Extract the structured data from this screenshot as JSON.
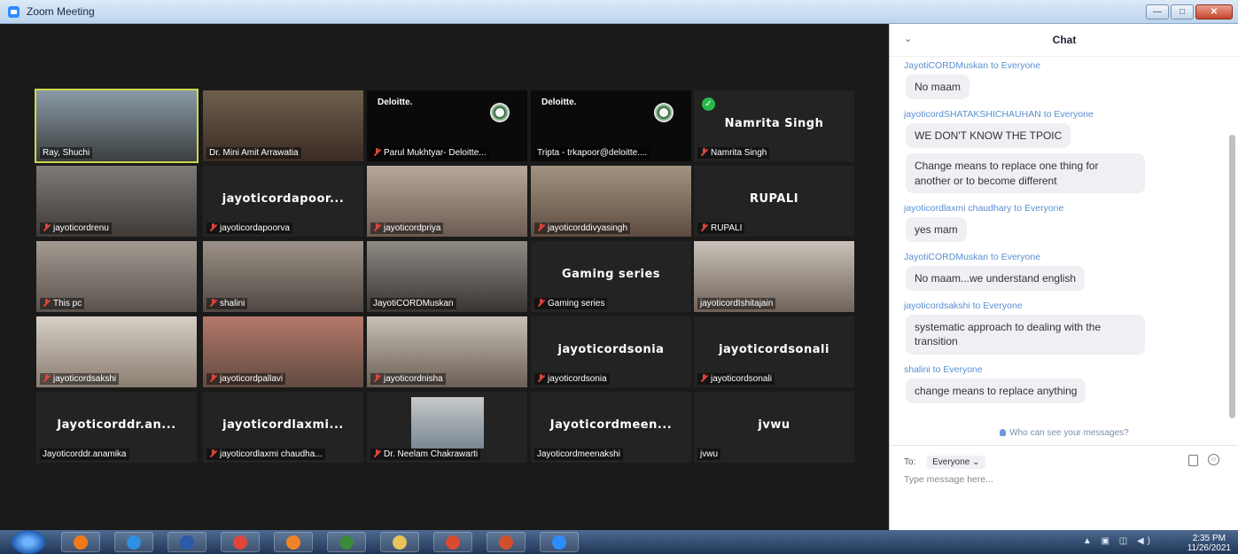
{
  "window": {
    "title": "Zoom Meeting",
    "buttons": [
      "—",
      "□",
      "✕"
    ]
  },
  "gallery": [
    {
      "name": "Ray, Shuchi",
      "big": "",
      "muted": false,
      "kind": "video",
      "bg": "linear-gradient(#8a9aa6,#3b3f3f)",
      "active": true
    },
    {
      "name": "Dr. Mini Amit Arrawatia",
      "big": "",
      "muted": false,
      "kind": "video",
      "bg": "linear-gradient(#6f5f4d,#3a2c24)"
    },
    {
      "name": "Parul Mukhtyar- Deloitte...",
      "big": "",
      "muted": true,
      "kind": "deloitte",
      "bg": "#0a0a0a"
    },
    {
      "name": "Tripta - trkapoor@deloitte....",
      "big": "",
      "muted": false,
      "kind": "deloitte",
      "bg": "#0a0a0a"
    },
    {
      "name": "Namrita Singh",
      "big": "Namrita Singh",
      "muted": true,
      "kind": "name",
      "check": true
    },
    {
      "name": "jayoticordrenu",
      "big": "",
      "muted": true,
      "kind": "video",
      "bg": "linear-gradient(#7e7a78,#3f3a36)"
    },
    {
      "name": "jayoticordapoorva",
      "big": "jayoticordapoor...",
      "muted": true,
      "kind": "name"
    },
    {
      "name": "jayoticordpriya",
      "big": "",
      "muted": true,
      "kind": "video",
      "bg": "linear-gradient(#b8a89a,#6c5b52)"
    },
    {
      "name": "jayoticorddivyasingh",
      "big": "",
      "muted": true,
      "kind": "video",
      "bg": "linear-gradient(#a49381,#5e4c40)"
    },
    {
      "name": "RUPALI",
      "big": "RUPALI",
      "muted": true,
      "kind": "name"
    },
    {
      "name": "This pc",
      "big": "",
      "muted": true,
      "kind": "video",
      "bg": "linear-gradient(#a39b92,#5b524c)"
    },
    {
      "name": "shalini",
      "big": "",
      "muted": true,
      "kind": "video",
      "bg": "linear-gradient(#9c9289,#4f4741)"
    },
    {
      "name": "JayotiCORDMuskan",
      "big": "",
      "muted": false,
      "kind": "video",
      "bg": "linear-gradient(#8e8a84,#3a3532)"
    },
    {
      "name": "Gaming series",
      "big": "Gaming series",
      "muted": true,
      "kind": "name"
    },
    {
      "name": "jayoticordIshitajain",
      "big": "",
      "muted": false,
      "kind": "video",
      "bg": "linear-gradient(#c9c2b9,#6f6259)"
    },
    {
      "name": "jayoticordsakshi",
      "big": "",
      "muted": true,
      "kind": "video",
      "bg": "linear-gradient(#d6d0c6,#8a7c70)"
    },
    {
      "name": "jayoticordpallavi",
      "big": "",
      "muted": true,
      "kind": "video",
      "bg": "linear-gradient(#b6786a,#604a40)"
    },
    {
      "name": "jayoticordnisha",
      "big": "",
      "muted": true,
      "kind": "video",
      "bg": "linear-gradient(#c5c0b6,#6d5f55)"
    },
    {
      "name": "jayoticordsonia",
      "big": "jayoticordsonia",
      "muted": true,
      "kind": "name"
    },
    {
      "name": "jayoticordsonali",
      "big": "jayoticordsonali",
      "muted": true,
      "kind": "name"
    },
    {
      "name": "Jayoticorddr.anamika",
      "big": "Jayoticorddr.an...",
      "muted": false,
      "kind": "name"
    },
    {
      "name": "jayoticordlaxmi chaudha...",
      "big": "jayoticordlaxmi...",
      "muted": true,
      "kind": "name"
    },
    {
      "name": "Dr. Neelam Chakrawarti",
      "big": "",
      "muted": true,
      "kind": "photo"
    },
    {
      "name": "Jayoticordmeenakshi",
      "big": "Jayoticordmeen...",
      "muted": false,
      "kind": "name"
    },
    {
      "name": "jvwu",
      "big": "jvwu",
      "muted": false,
      "kind": "name"
    }
  ],
  "deloitte_text": "Deloitte.",
  "chat": {
    "title": "Chat",
    "messages": [
      {
        "from": "JayotiCORDMuskan to Everyone",
        "text": "No maam"
      },
      {
        "from": "jayoticordSHATAKSHICHAUHAN to Everyone",
        "text": "WE DON'T KNOW THE TPOIC"
      },
      {
        "from": "",
        "text": "Change means to replace one thing for another or to become different"
      },
      {
        "from": "jayoticordlaxmi chaudhary to Everyone",
        "text": "yes mam"
      },
      {
        "from": "JayotiCORDMuskan to Everyone",
        "text": "No maam...we understand english"
      },
      {
        "from": "jayoticordsakshi to Everyone",
        "text": "systematic approach to dealing with the transition"
      },
      {
        "from": "shalini to Everyone",
        "text": "change means to replace anything"
      }
    ],
    "who_can_see": "Who can see your messages?",
    "to_label": "To:",
    "to_value": "Everyone",
    "input_placeholder": "Type message here..."
  },
  "taskbar": {
    "time": "2:35 PM",
    "date": "11/26/2021",
    "apps": [
      {
        "name": "media-player",
        "color": "#f07a1a"
      },
      {
        "name": "internet-explorer",
        "color": "#2f8fe0"
      },
      {
        "name": "word",
        "color": "#2a5aa8"
      },
      {
        "name": "chrome",
        "color": "#e0463a"
      },
      {
        "name": "firefox",
        "color": "#f0832a"
      },
      {
        "name": "excel",
        "color": "#3a8a3a"
      },
      {
        "name": "file-explorer",
        "color": "#e8c35a"
      },
      {
        "name": "snagit",
        "color": "#d94a30"
      },
      {
        "name": "powerpoint",
        "color": "#d0502c"
      },
      {
        "name": "zoom",
        "color": "#2d8cff"
      }
    ]
  }
}
